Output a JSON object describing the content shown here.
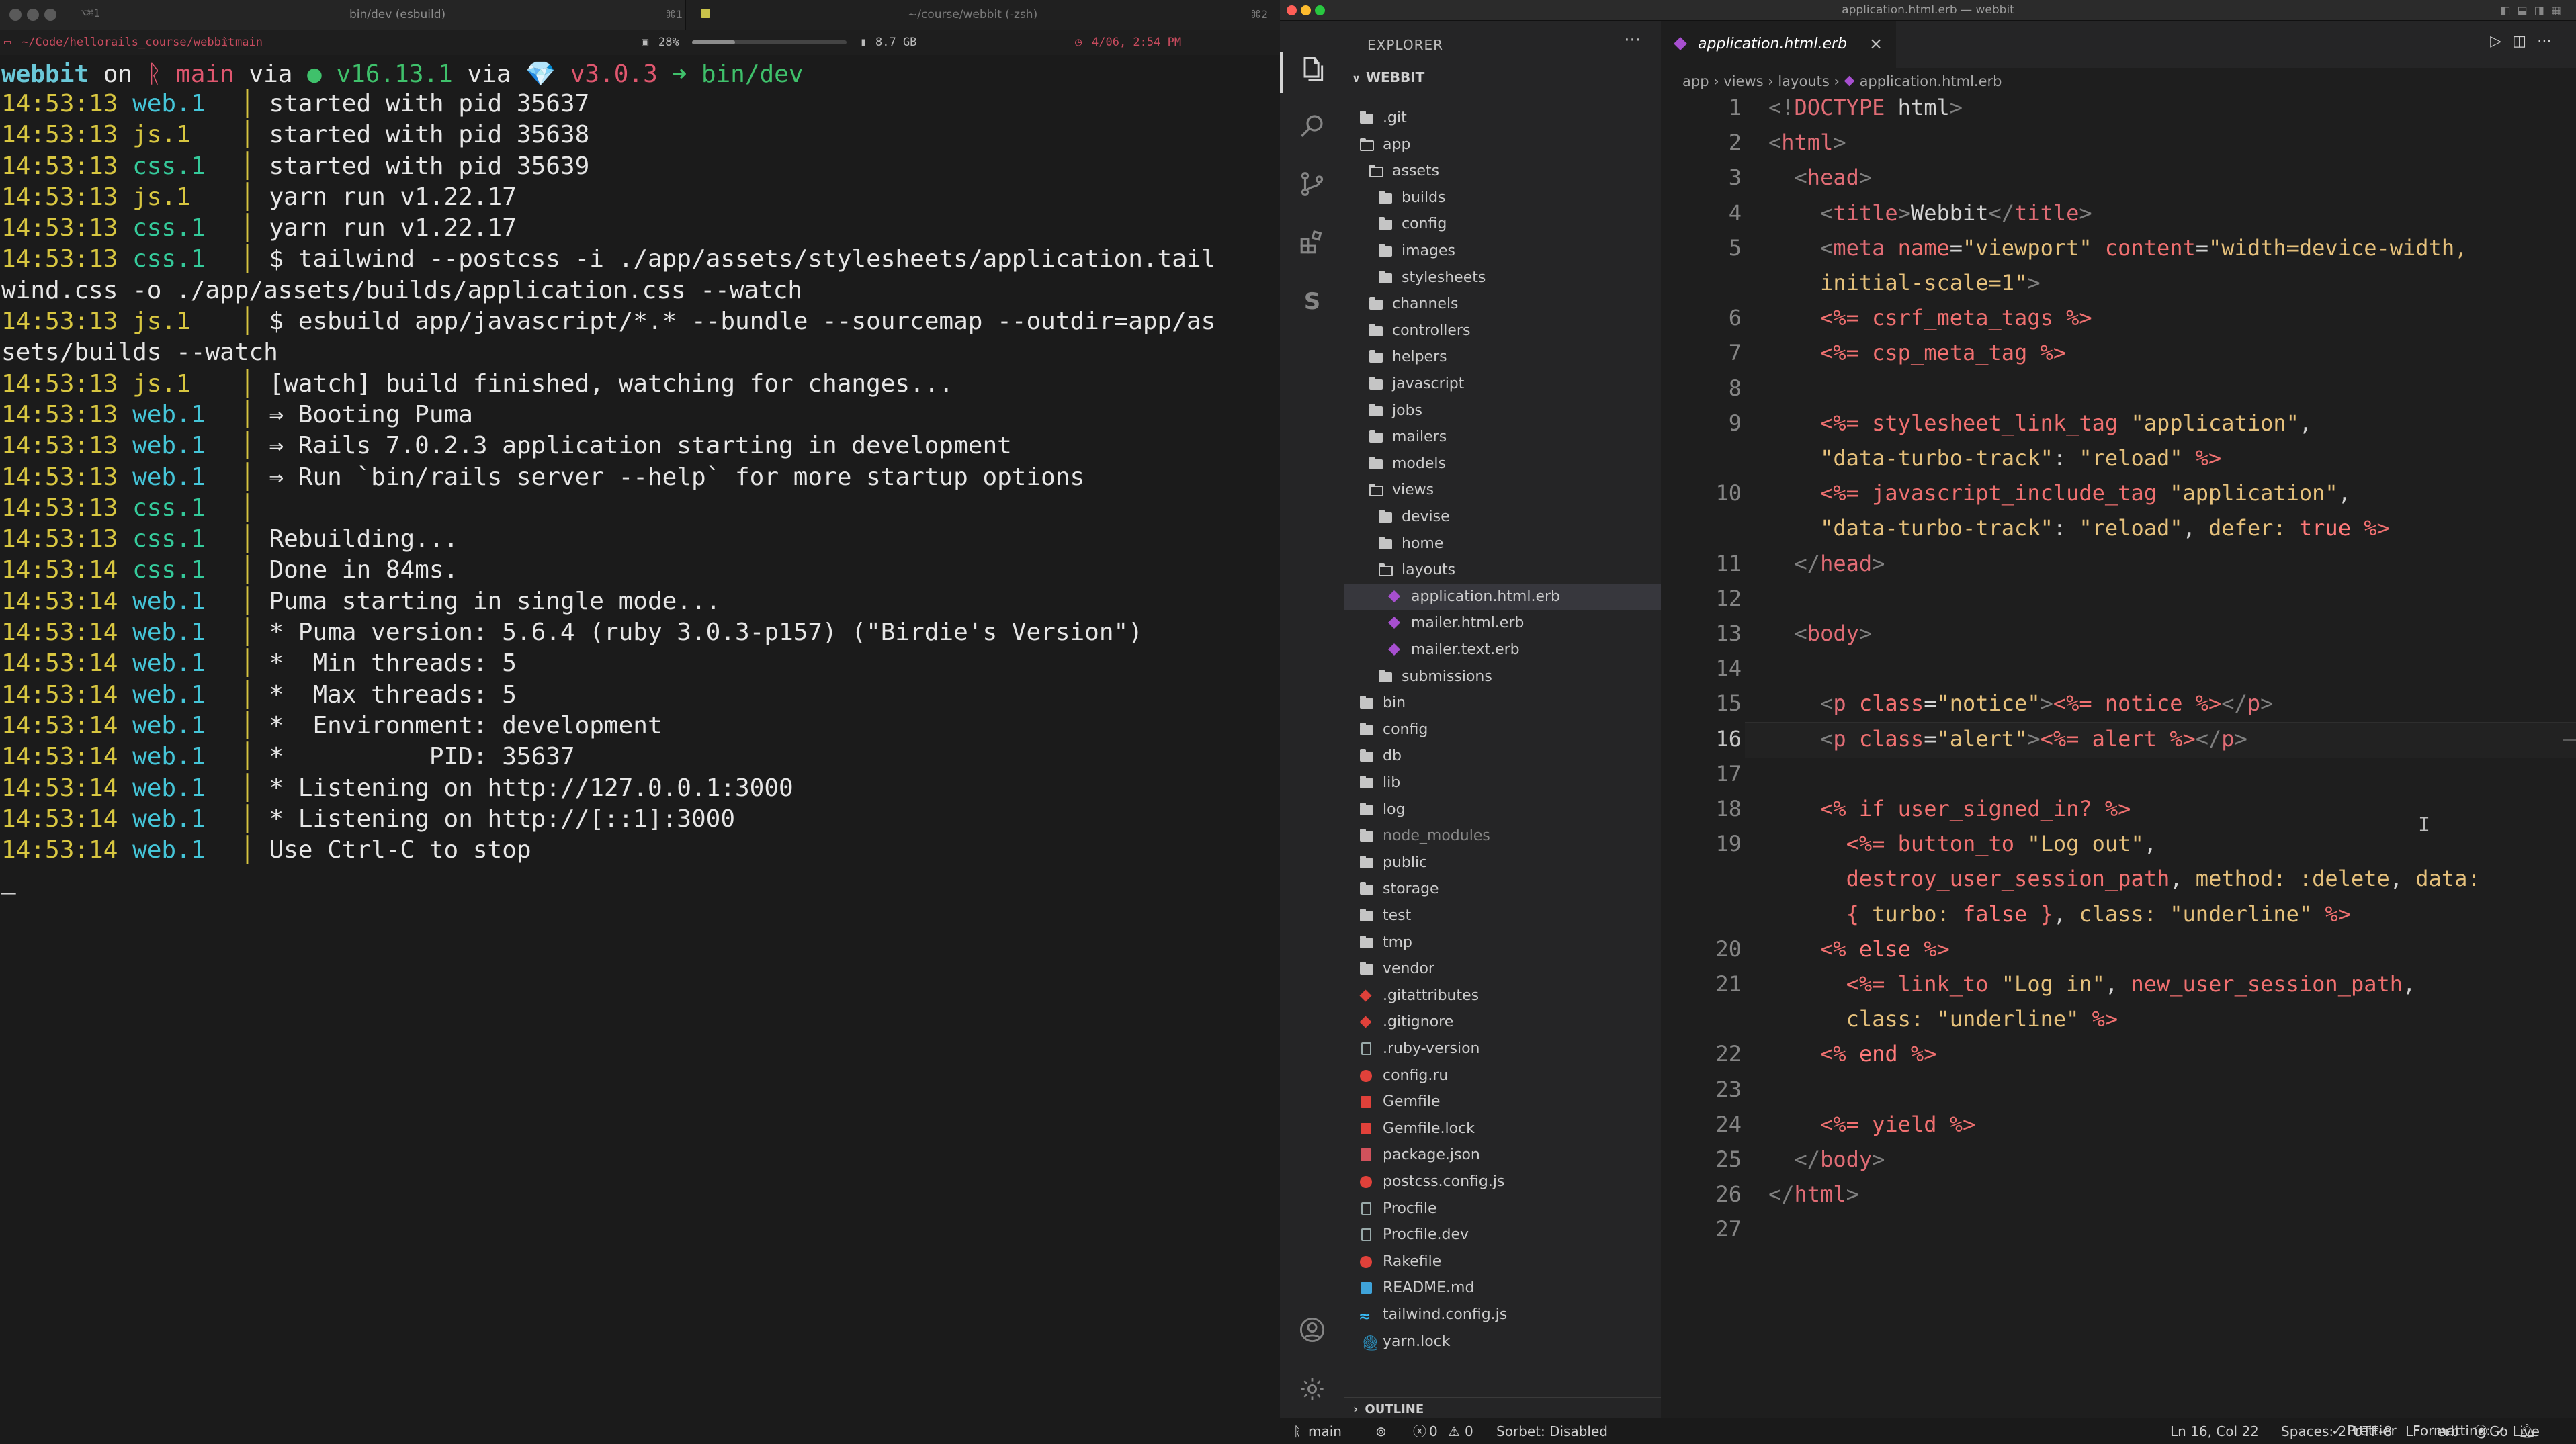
{
  "terminal": {
    "shortcut_left": "⌥⌘1",
    "tab_left": "bin/dev (esbuild)",
    "tab_left_shortcut": "⌘1",
    "tab_right": "~/course/webbit (-zsh)",
    "tab_right_shortcut": "⌘2",
    "status_path": "~/Code/hellorails_course/webbit",
    "status_branch": "main",
    "status_cpu": "28%",
    "status_mem": "8.7 GB",
    "status_time": "4/06, 2:54 PM",
    "cpu_fraction": 0.28,
    "prompt": {
      "dir": "webbit",
      "on": " on ",
      "branch": "ᚱ main",
      "via1": " via ",
      "node": "● v16.13.1",
      "via2": " via ",
      "ruby": "💎 v3.0.3",
      "arrow": " ➜ ",
      "cmd": "bin/dev"
    },
    "lines": [
      {
        "ts": "14:53:13",
        "proc": "web.1",
        "kind": "web",
        "text": "started with pid 35637"
      },
      {
        "ts": "14:53:13",
        "proc": "js.1",
        "kind": "js",
        "text": "started with pid 35638"
      },
      {
        "ts": "14:53:13",
        "proc": "css.1",
        "kind": "css",
        "text": "started with pid 35639"
      },
      {
        "ts": "14:53:13",
        "proc": "js.1",
        "kind": "js",
        "text": "yarn run v1.22.17"
      },
      {
        "ts": "14:53:13",
        "proc": "css.1",
        "kind": "css",
        "text": "yarn run v1.22.17"
      },
      {
        "ts": "14:53:13",
        "proc": "css.1",
        "kind": "css",
        "text": "$ tailwind --postcss -i ./app/assets/stylesheets/application.tail"
      },
      {
        "ts": "",
        "proc": "",
        "kind": "wrap",
        "text": "wind.css -o ./app/assets/builds/application.css --watch"
      },
      {
        "ts": "14:53:13",
        "proc": "js.1",
        "kind": "js",
        "text": "$ esbuild app/javascript/*.* --bundle --sourcemap --outdir=app/as"
      },
      {
        "ts": "",
        "proc": "",
        "kind": "wrap",
        "text": "sets/builds --watch"
      },
      {
        "ts": "14:53:13",
        "proc": "js.1",
        "kind": "js",
        "text": "[watch] build finished, watching for changes..."
      },
      {
        "ts": "14:53:13",
        "proc": "web.1",
        "kind": "web",
        "text": "⇒ Booting Puma"
      },
      {
        "ts": "14:53:13",
        "proc": "web.1",
        "kind": "web",
        "text": "⇒ Rails 7.0.2.3 application starting in development"
      },
      {
        "ts": "14:53:13",
        "proc": "web.1",
        "kind": "web",
        "text": "⇒ Run `bin/rails server --help` for more startup options"
      },
      {
        "ts": "14:53:13",
        "proc": "css.1",
        "kind": "css",
        "text": ""
      },
      {
        "ts": "14:53:13",
        "proc": "css.1",
        "kind": "css",
        "text": "Rebuilding..."
      },
      {
        "ts": "14:53:14",
        "proc": "css.1",
        "kind": "css",
        "text": "Done in 84ms."
      },
      {
        "ts": "14:53:14",
        "proc": "web.1",
        "kind": "web",
        "text": "Puma starting in single mode..."
      },
      {
        "ts": "14:53:14",
        "proc": "web.1",
        "kind": "web",
        "text": "* Puma version: 5.6.4 (ruby 3.0.3-p157) (\"Birdie's Version\")"
      },
      {
        "ts": "14:53:14",
        "proc": "web.1",
        "kind": "web",
        "text": "*  Min threads: 5"
      },
      {
        "ts": "14:53:14",
        "proc": "web.1",
        "kind": "web",
        "text": "*  Max threads: 5"
      },
      {
        "ts": "14:53:14",
        "proc": "web.1",
        "kind": "web",
        "text": "*  Environment: development"
      },
      {
        "ts": "14:53:14",
        "proc": "web.1",
        "kind": "web",
        "text": "*          PID: 35637"
      },
      {
        "ts": "14:53:14",
        "proc": "web.1",
        "kind": "web",
        "text": "* Listening on http://127.0.0.1:3000"
      },
      {
        "ts": "14:53:14",
        "proc": "web.1",
        "kind": "web",
        "text": "* Listening on http://[::1]:3000"
      },
      {
        "ts": "14:53:14",
        "proc": "web.1",
        "kind": "web",
        "text": "Use Ctrl-C to stop"
      }
    ],
    "cursor": "_"
  },
  "vscode": {
    "window_title": "application.html.erb — webbit",
    "explorer_title": "EXPLORER",
    "explorer_more": "···",
    "root": "WEBBIT",
    "tree": [
      {
        "label": ".git",
        "type": "folder",
        "depth": 0
      },
      {
        "label": "app",
        "type": "folder-open",
        "depth": 0
      },
      {
        "label": "assets",
        "type": "folder-open",
        "depth": 1
      },
      {
        "label": "builds",
        "type": "folder",
        "depth": 2
      },
      {
        "label": "config",
        "type": "folder",
        "depth": 2
      },
      {
        "label": "images",
        "type": "folder",
        "depth": 2
      },
      {
        "label": "stylesheets",
        "type": "folder",
        "depth": 2
      },
      {
        "label": "channels",
        "type": "folder",
        "depth": 1
      },
      {
        "label": "controllers",
        "type": "folder",
        "depth": 1
      },
      {
        "label": "helpers",
        "type": "folder",
        "depth": 1
      },
      {
        "label": "javascript",
        "type": "folder",
        "depth": 1
      },
      {
        "label": "jobs",
        "type": "folder",
        "depth": 1
      },
      {
        "label": "mailers",
        "type": "folder",
        "depth": 1
      },
      {
        "label": "models",
        "type": "folder",
        "depth": 1
      },
      {
        "label": "views",
        "type": "folder-open",
        "depth": 1
      },
      {
        "label": "devise",
        "type": "folder",
        "depth": 2
      },
      {
        "label": "home",
        "type": "folder",
        "depth": 2
      },
      {
        "label": "layouts",
        "type": "folder-open",
        "depth": 2
      },
      {
        "label": "application.html.erb",
        "type": "erb",
        "depth": 3,
        "selected": true
      },
      {
        "label": "mailer.html.erb",
        "type": "erb",
        "depth": 3
      },
      {
        "label": "mailer.text.erb",
        "type": "erb",
        "depth": 3
      },
      {
        "label": "submissions",
        "type": "folder",
        "depth": 2
      },
      {
        "label": "bin",
        "type": "folder",
        "depth": 0
      },
      {
        "label": "config",
        "type": "folder",
        "depth": 0
      },
      {
        "label": "db",
        "type": "folder",
        "depth": 0
      },
      {
        "label": "lib",
        "type": "folder",
        "depth": 0
      },
      {
        "label": "log",
        "type": "folder",
        "depth": 0
      },
      {
        "label": "node_modules",
        "type": "folder",
        "depth": 0,
        "dim": true
      },
      {
        "label": "public",
        "type": "folder",
        "depth": 0
      },
      {
        "label": "storage",
        "type": "folder",
        "depth": 0
      },
      {
        "label": "test",
        "type": "folder",
        "depth": 0
      },
      {
        "label": "tmp",
        "type": "folder",
        "depth": 0
      },
      {
        "label": "vendor",
        "type": "folder",
        "depth": 0
      },
      {
        "label": ".gitattributes",
        "type": "git",
        "depth": 0
      },
      {
        "label": ".gitignore",
        "type": "git",
        "depth": 0
      },
      {
        "label": ".ruby-version",
        "type": "file",
        "depth": 0
      },
      {
        "label": "config.ru",
        "type": "ruby",
        "depth": 0
      },
      {
        "label": "Gemfile",
        "type": "gem",
        "depth": 0
      },
      {
        "label": "Gemfile.lock",
        "type": "gem",
        "depth": 0
      },
      {
        "label": "package.json",
        "type": "json",
        "depth": 0
      },
      {
        "label": "postcss.config.js",
        "type": "ruby",
        "depth": 0
      },
      {
        "label": "Procfile",
        "type": "file",
        "depth": 0
      },
      {
        "label": "Procfile.dev",
        "type": "file",
        "depth": 0
      },
      {
        "label": "Rakefile",
        "type": "ruby",
        "depth": 0
      },
      {
        "label": "README.md",
        "type": "md",
        "depth": 0
      },
      {
        "label": "tailwind.config.js",
        "type": "tw",
        "depth": 0
      },
      {
        "label": "yarn.lock",
        "type": "yarn",
        "depth": 0
      }
    ],
    "outline_label": "OUTLINE",
    "tab_label": "application.html.erb",
    "tab_close": "×",
    "breadcrumb": [
      "app",
      "views",
      "layouts",
      "application.html.erb"
    ],
    "breadcrumb_sep": " › ",
    "active_line": 16,
    "code": [
      {
        "n": "1",
        "html": "<span class='br'>&lt;!</span><span class='tg'>DOCTYPE</span> html<span class='br'>&gt;</span>"
      },
      {
        "n": "2",
        "html": "<span class='br'>&lt;</span><span class='tg'>html</span><span class='br'>&gt;</span>"
      },
      {
        "n": "3",
        "html": "  <span class='br'>&lt;</span><span class='tg'>head</span><span class='br'>&gt;</span>"
      },
      {
        "n": "4",
        "html": "    <span class='br'>&lt;</span><span class='tg'>title</span><span class='br'>&gt;</span>Webbit<span class='br'>&lt;/</span><span class='tg'>title</span><span class='br'>&gt;</span>"
      },
      {
        "n": "5",
        "html": "    <span class='br'>&lt;</span><span class='tg'>meta</span> <span class='at'>name</span>=<span class='st'>\"viewport\"</span> <span class='at'>content</span>=<span class='st'>\"width=device-width,</span>"
      },
      {
        "n": "",
        "html": "    <span class='st'>initial-scale=1\"</span><span class='br'>&gt;</span>"
      },
      {
        "n": "6",
        "html": "    <span class='er'>&lt;%=</span> <span class='rv'>csrf_meta_tags</span> <span class='er'>%&gt;</span>"
      },
      {
        "n": "7",
        "html": "    <span class='er'>&lt;%=</span> <span class='rv'>csp_meta_tag</span> <span class='er'>%&gt;</span>"
      },
      {
        "n": "8",
        "html": ""
      },
      {
        "n": "9",
        "html": "    <span class='er'>&lt;%=</span> <span class='rv'>stylesheet_link_tag</span> <span class='st'>\"application\"</span>,"
      },
      {
        "n": "",
        "html": "    <span class='st'>\"data-turbo-track\"</span>: <span class='st'>\"reload\"</span> <span class='er'>%&gt;</span>"
      },
      {
        "n": "10",
        "html": "    <span class='er'>&lt;%=</span> <span class='rv'>javascript_include_tag</span> <span class='st'>\"application\"</span>,"
      },
      {
        "n": "",
        "html": "    <span class='st'>\"data-turbo-track\"</span>: <span class='st'>\"reload\"</span>, <span class='sym'>defer:</span> <span class='kw'>true</span> <span class='er'>%&gt;</span>"
      },
      {
        "n": "11",
        "html": "  <span class='br'>&lt;/</span><span class='tg'>head</span><span class='br'>&gt;</span>"
      },
      {
        "n": "12",
        "html": ""
      },
      {
        "n": "13",
        "html": "  <span class='br'>&lt;</span><span class='tg'>body</span><span class='br'>&gt;</span>"
      },
      {
        "n": "14",
        "html": ""
      },
      {
        "n": "15",
        "html": "    <span class='br'>&lt;</span><span class='tg'>p</span> <span class='at'>class</span>=<span class='st'>\"notice\"</span><span class='br'>&gt;</span><span class='er'>&lt;%=</span> <span class='rv'>notice</span> <span class='er'>%&gt;</span><span class='br'>&lt;/</span><span class='tg'>p</span><span class='br'>&gt;</span>"
      },
      {
        "n": "16",
        "html": "    <span class='br'>&lt;</span><span class='tg'>p</span> <span class='at'>class</span>=<span class='st'>\"alert\"</span><span class='br'>&gt;</span><span class='er'>&lt;%=</span> <span class='rv'>alert</span> <span class='er'>%&gt;</span><span class='br'>&lt;/</span><span class='tg'>p</span><span class='br'>&gt;</span>"
      },
      {
        "n": "17",
        "html": ""
      },
      {
        "n": "18",
        "html": "    <span class='er'>&lt;%</span> <span class='kw'>if</span> <span class='rv'>user_signed_in?</span> <span class='er'>%&gt;</span>"
      },
      {
        "n": "19",
        "html": "      <span class='er'>&lt;%=</span> <span class='rv'>button_to</span> <span class='st'>\"Log out\"</span>,"
      },
      {
        "n": "",
        "html": "      <span class='rv'>destroy_user_session_path</span>, <span class='sym'>method:</span> <span class='sym'>:delete</span>, <span class='sym'>data:</span>"
      },
      {
        "n": "",
        "html": "      <span class='er'>{</span> <span class='sym'>turbo:</span> <span class='kw'>false</span> <span class='er'>}</span>, <span class='sym'>class:</span> <span class='st'>\"underline\"</span> <span class='er'>%&gt;</span>"
      },
      {
        "n": "20",
        "html": "    <span class='er'>&lt;%</span> <span class='kw'>else</span> <span class='er'>%&gt;</span>"
      },
      {
        "n": "21",
        "html": "      <span class='er'>&lt;%=</span> <span class='rv'>link_to</span> <span class='st'>\"Log in\"</span>, <span class='rv'>new_user_session_path</span>,"
      },
      {
        "n": "",
        "html": "      <span class='sym'>class:</span> <span class='st'>\"underline\"</span> <span class='er'>%&gt;</span>"
      },
      {
        "n": "22",
        "html": "    <span class='er'>&lt;%</span> <span class='kw'>end</span> <span class='er'>%&gt;</span>"
      },
      {
        "n": "23",
        "html": ""
      },
      {
        "n": "24",
        "html": "    <span class='er'>&lt;%=</span> <span class='rv'>yield</span> <span class='er'>%&gt;</span>"
      },
      {
        "n": "25",
        "html": "  <span class='br'>&lt;/</span><span class='tg'>body</span><span class='br'>&gt;</span>"
      },
      {
        "n": "26",
        "html": "<span class='br'>&lt;/</span><span class='tg'>html</span><span class='br'>&gt;</span>"
      },
      {
        "n": "27",
        "html": ""
      }
    ],
    "status": {
      "branch": "main",
      "errors": "0",
      "warnings": "0",
      "sorbet": "Sorbet: Disabled",
      "position": "Ln 16, Col 22",
      "spaces": "Spaces: 2",
      "encoding": "UTF-8",
      "eol": "LF",
      "language": "erb",
      "golive": "Go Live",
      "prettier": "Prettier",
      "formatting": "Formatting: ✓"
    }
  }
}
